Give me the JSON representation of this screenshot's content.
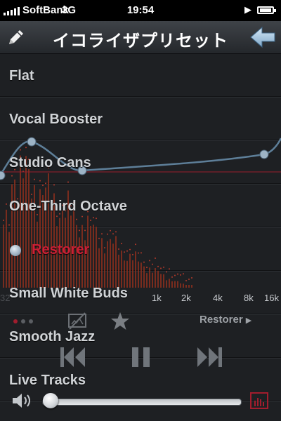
{
  "status_bar": {
    "carrier": "SoftBank",
    "network": "3G",
    "time": "19:54"
  },
  "nav": {
    "title": "イコライザプリセット",
    "edit_icon": "pencil-icon",
    "back_icon": "back-arrow-icon"
  },
  "presets": [
    {
      "label": "Flat"
    },
    {
      "label": "Vocal Booster"
    },
    {
      "label": "Studio Cans"
    },
    {
      "label": "One-Third Octave"
    },
    {
      "label": "Restorer",
      "selected": true
    },
    {
      "label": "Small White Buds"
    },
    {
      "label": "Smooth Jazz"
    },
    {
      "label": "Live Tracks"
    }
  ],
  "spectrum": {
    "frequency_labels": [
      "32",
      "1k",
      "2k",
      "4k",
      "8k",
      "16k"
    ]
  },
  "controls": {
    "current_preset": "Restorer",
    "page_indicator": {
      "count": 3,
      "current": 0
    },
    "volume_level": 0.02,
    "icons": [
      "screen-off-icon",
      "star-icon",
      "rewind-icon",
      "pause-icon",
      "fast-forward-icon",
      "speaker-icon",
      "spectrum-icon"
    ]
  },
  "colors": {
    "accent": "#cc1f36",
    "curve": "#5e7f99",
    "bars": "#8a2f1d"
  }
}
